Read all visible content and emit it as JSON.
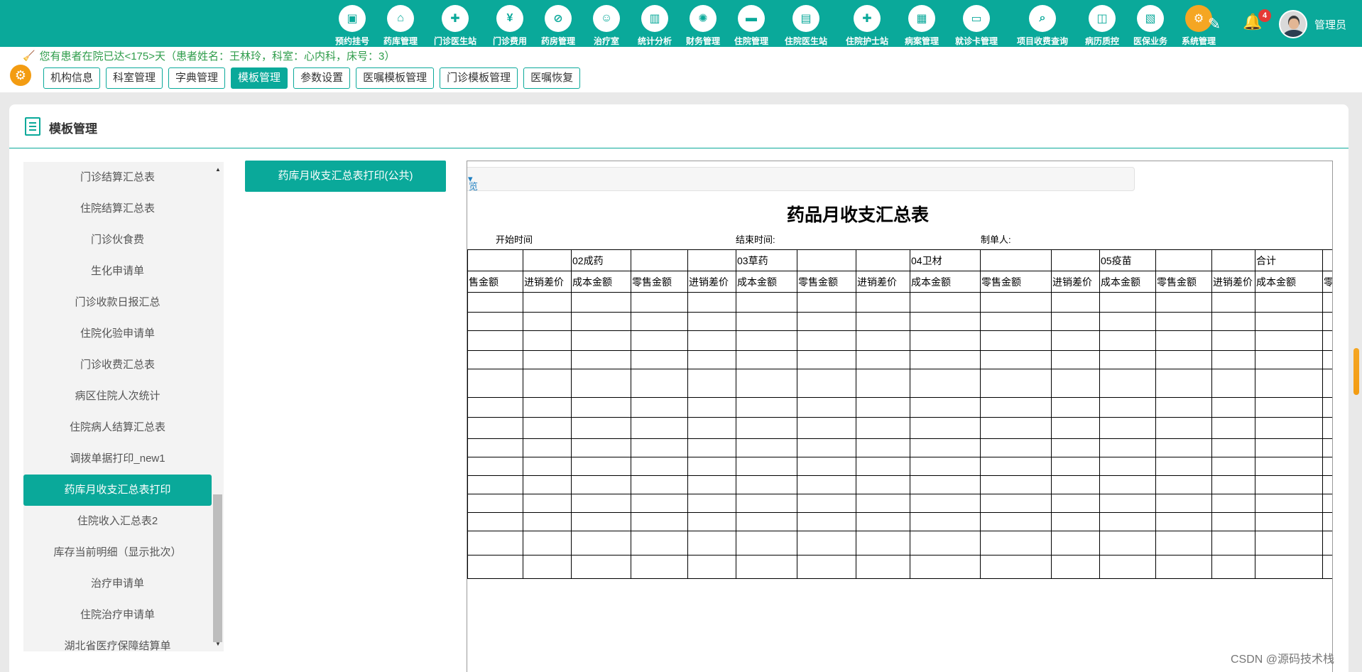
{
  "nav": {
    "items": [
      {
        "label": "预约挂号",
        "icon": "calendar-icon"
      },
      {
        "label": "药库管理",
        "icon": "warehouse-icon"
      },
      {
        "label": "门诊医生站",
        "icon": "doctor-icon"
      },
      {
        "label": "门诊费用",
        "icon": "yuan-icon"
      },
      {
        "label": "药房管理",
        "icon": "pill-icon"
      },
      {
        "label": "治疗室",
        "icon": "treatment-icon"
      },
      {
        "label": "统计分析",
        "icon": "chart-icon"
      },
      {
        "label": "财务管理",
        "icon": "finance-icon"
      },
      {
        "label": "住院管理",
        "icon": "bed-icon"
      },
      {
        "label": "住院医生站",
        "icon": "inpatient-doctor-icon"
      },
      {
        "label": "住院护士站",
        "icon": "nurse-icon"
      },
      {
        "label": "病案管理",
        "icon": "record-icon"
      },
      {
        "label": "就诊卡管理",
        "icon": "card-icon"
      },
      {
        "label": "项目收费查询",
        "icon": "search-doc-icon"
      },
      {
        "label": "病历质控",
        "icon": "quality-icon"
      },
      {
        "label": "医保业务",
        "icon": "insurance-icon"
      },
      {
        "label": "系统管理",
        "icon": "gear-icon"
      }
    ],
    "notification_count": "4",
    "user_name": "管理员"
  },
  "notice": {
    "text": "您有患者在院已达<175>天（患者姓名：王林玲，科室：心内科，床号：3）"
  },
  "toolbar": {
    "buttons": [
      "机构信息",
      "科室管理",
      "字典管理",
      "模板管理",
      "参数设置",
      "医嘱模板管理",
      "门诊模板管理",
      "医嘱恢复"
    ],
    "active": "模板管理"
  },
  "panel": {
    "title": "模板管理"
  },
  "template_list": {
    "items": [
      "门诊结算汇总表",
      "住院结算汇总表",
      "门诊伙食费",
      "生化申请单",
      "门诊收款日报汇总",
      "住院化验申请单",
      "门诊收费汇总表",
      "病区住院人次统计",
      "住院病人结算汇总表",
      "调拨单据打印_new1",
      "药库月收支汇总表打印",
      "住院收入汇总表2",
      "库存当前明细（显示批次）",
      "治疗申请单",
      "住院治疗申请单",
      "湖北省医疗保障结算单"
    ],
    "active": "药库月收支汇总表打印"
  },
  "template_button": {
    "label": "药库月收支汇总表打印(公共)"
  },
  "preview": {
    "toolbar_text": "览",
    "report_title": "药品月收支汇总表",
    "start_label": "开始时间",
    "end_label": "结束时间:",
    "maker_label": "制单人:",
    "group_row": [
      "",
      "",
      "02成药",
      "",
      "",
      "03草药",
      "",
      "",
      "04卫材",
      "",
      "",
      "05疫苗",
      "",
      "",
      "合计",
      ""
    ],
    "header_row": [
      "售金额",
      "进销差价",
      "成本金额",
      "零售金额",
      "进销差价",
      "成本金额",
      "零售金额",
      "进销差价",
      "成本金额",
      "零售金额",
      "进销差价",
      "成本金额",
      "零售金额",
      "进销差价",
      "成本金额",
      "零"
    ]
  },
  "watermark": "CSDN @源码技术栈"
}
